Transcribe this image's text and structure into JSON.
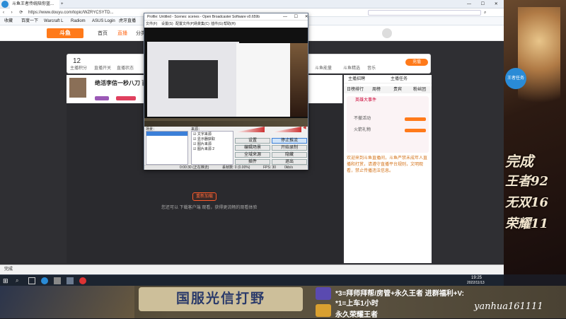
{
  "browser": {
    "tab_title": "斗鱼王者传统陪你蓝...",
    "url": "https://www.douyu.com/topic/WZRYCSYTD...",
    "bookmarks": [
      "收藏",
      "百度一下",
      "Warcraft L",
      "Radiom",
      "ASUS Login",
      "虎牙直播"
    ]
  },
  "site": {
    "nav": [
      "首页",
      "直播",
      "分类"
    ],
    "user_level": "12",
    "user_stats": [
      "主播积分",
      "直播开关",
      "直播状态"
    ],
    "room_title": "绝活李信一秒八刀 百里",
    "right_icons": [
      "斗鱼能量",
      "斗鱼精选",
      "音乐"
    ],
    "follow_button": "已关注",
    "ptab": [
      "主播招聘",
      "主播任务"
    ],
    "chat_tabs": [
      "日榜排行",
      "周榜",
      "贵宾",
      "粉丝团"
    ],
    "event_title": "英雄大事件",
    "notice": "欢迎来到斗鱼直播间，斗鱼严禁未成年人直播和打赏，请遵守直播平台规则，文明观看，禁止传播违法信息。",
    "center_button": "重新加载",
    "center_hint": "您还可以 下载客户端 观看，获得更流畅的观看体验",
    "activity_lines": [
      "不撤活动",
      "火箭礼物"
    ],
    "status_left": "完成"
  },
  "obs": {
    "title": "Profile: Untitled - Scenes: scenes - Open Broadcaster Software v0.659b",
    "menu": [
      "文件(F)",
      "设置(S)",
      "配置文件(P)",
      "场景集(C)",
      "插件(G)",
      "帮助(H)"
    ],
    "scenes_label": "场景：",
    "sources_label": "来源：",
    "sources": [
      "文字来源",
      "显示器获取",
      "图片来源",
      "图片来源 2"
    ],
    "buttons": [
      "设置",
      "停止推流",
      "编辑场景",
      "开始录制",
      "全域来源",
      "隐藏",
      "插件",
      "退出"
    ],
    "status": [
      "0:00:30 (正在推流)",
      "丢帧数: 0 (0.00%)",
      "FPS: 30",
      "0kb/s"
    ]
  },
  "promo": {
    "lines": [
      "完成",
      "王者92",
      "无双16",
      "荣耀11"
    ],
    "badge": "王者任务"
  },
  "taskbar": {
    "time": "19:25",
    "date": "2022/11/13"
  },
  "overlay": {
    "banner": "国服光信打野",
    "info1": "*3=拜师拜帮/房管+永久王者  进群福利+V:",
    "info2": "*1=上车1小时",
    "info3": "永久荣耀王者",
    "wechat": "yanhua161111"
  }
}
